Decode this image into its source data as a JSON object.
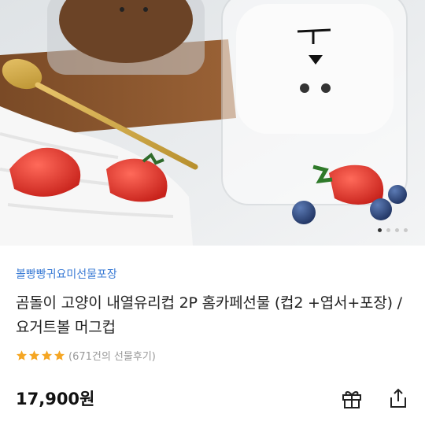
{
  "carousel": {
    "page_count": 4,
    "active_index": 0
  },
  "product": {
    "store_name": "볼빵빵귀요미선물포장",
    "title": "곰돌이 고양이 내열유리컵 2P 홈카페선물 (컵2 +엽서+포장) / 요거트볼 머그컵",
    "rating": 4,
    "review_text": "(671건의 선물후기)",
    "price": "17,900원"
  },
  "colors": {
    "store": "#3a7bd5",
    "star": "#f5a623",
    "review": "#999999"
  },
  "icons": {
    "gift": "gift-icon",
    "share": "share-icon"
  }
}
